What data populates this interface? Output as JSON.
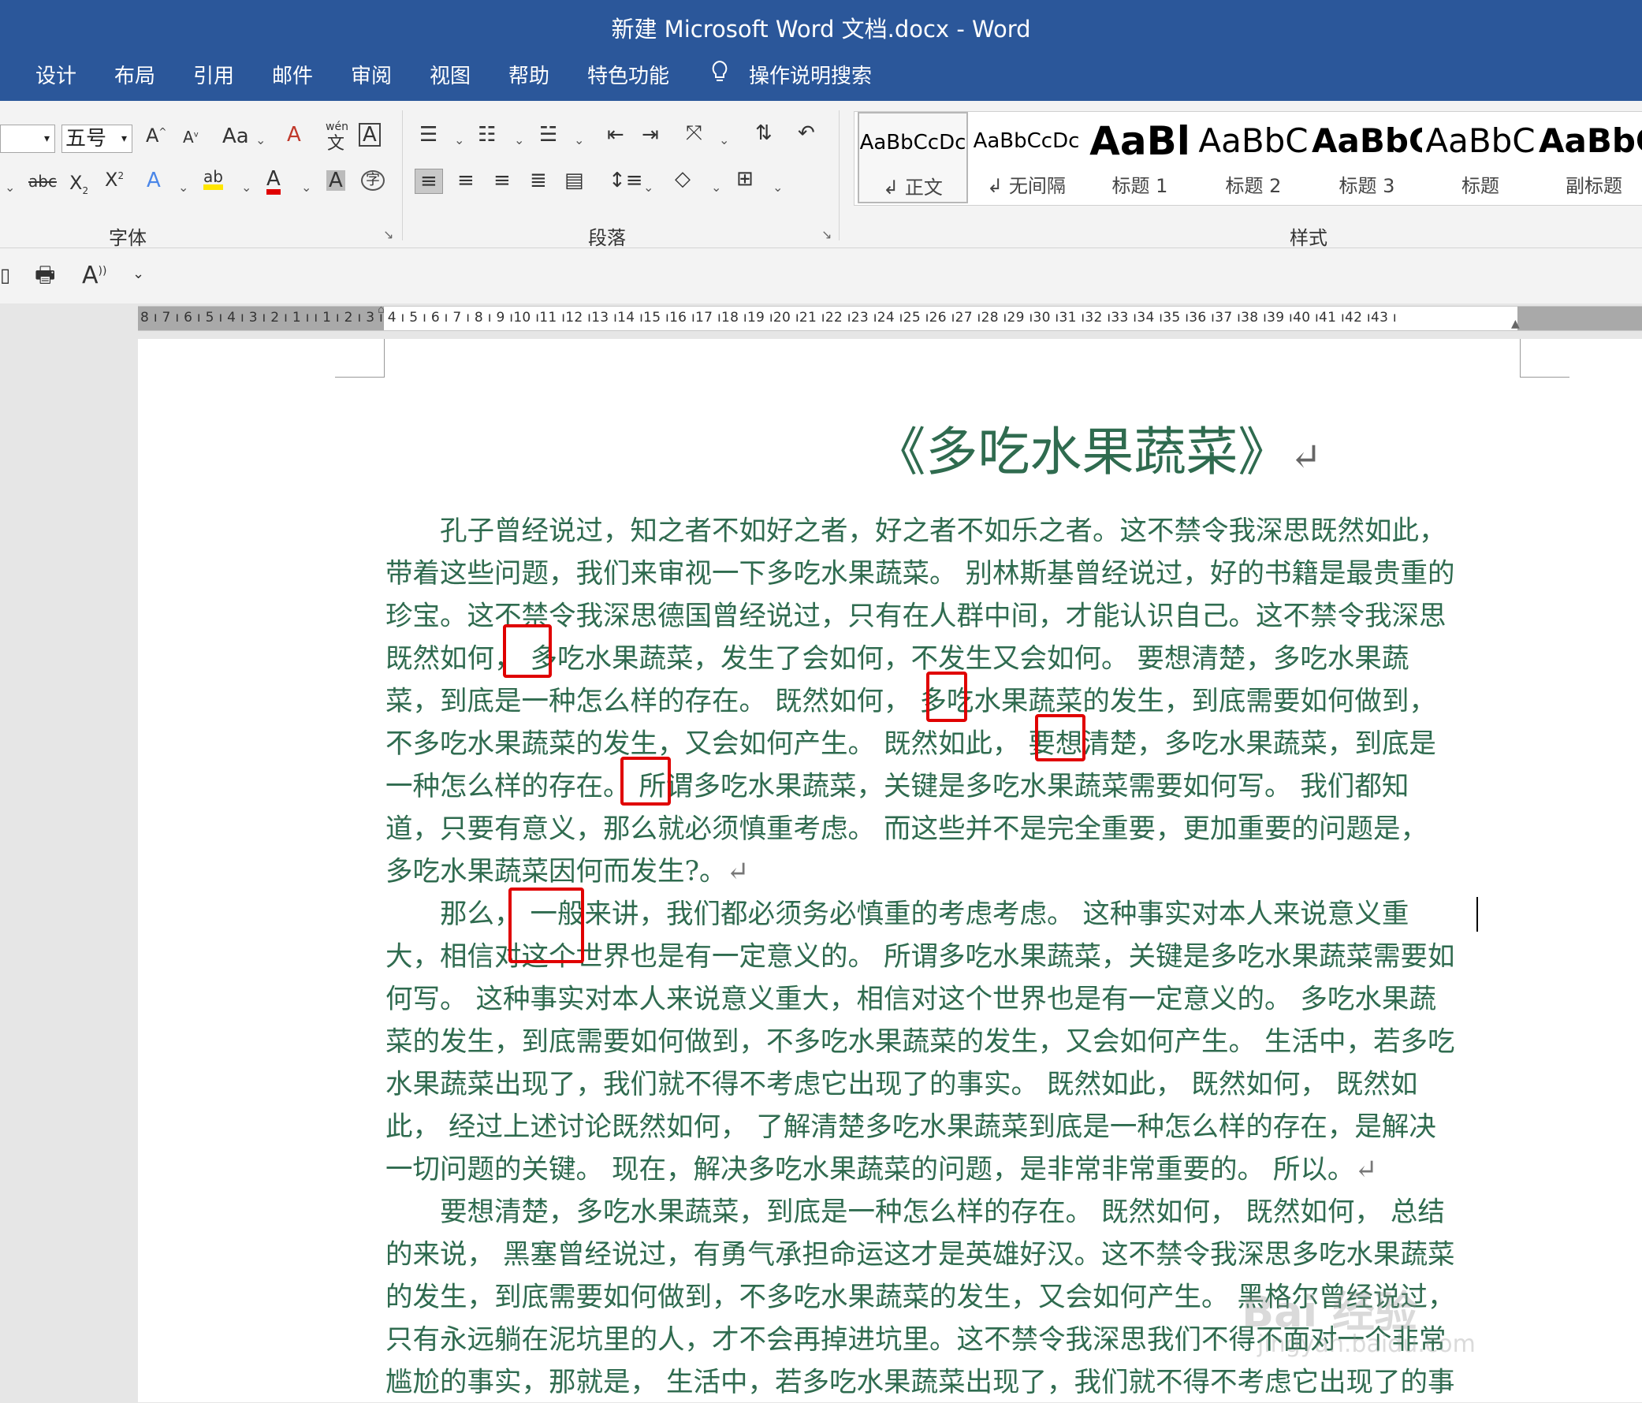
{
  "window": {
    "title": "新建 Microsoft Word 文档.docx  -  Word"
  },
  "tabs": [
    "设计",
    "布局",
    "引用",
    "邮件",
    "审阅",
    "视图",
    "帮助",
    "特色功能"
  ],
  "tell_me": "操作说明搜索",
  "font": {
    "size": "五号",
    "group_label": "字体",
    "case_btn": "Aa",
    "phonetic": "wén"
  },
  "paragraph": {
    "group_label": "段落"
  },
  "styles": {
    "group_label": "样式",
    "items": [
      {
        "preview": "AaBbCcDc",
        "name": "↲ 正文"
      },
      {
        "preview": "AaBbCcDc",
        "name": "↲ 无间隔"
      },
      {
        "preview": "AaBl",
        "name": "标题 1"
      },
      {
        "preview": "AaBbC",
        "name": "标题 2"
      },
      {
        "preview": "AaBbC",
        "name": "标题 3"
      },
      {
        "preview": "AaBbC",
        "name": "标题"
      },
      {
        "preview": "AaBbC",
        "name": "副标题"
      }
    ]
  },
  "ruler": {
    "text": "8 ı 7 ı 6 ı 5 ı 4 ı 3 ı 2 ı 1 ı     ı 1 ı 2 ı 3 ı 4 ı 5 ı 6 ı 7 ı 8 ı 9 ı10 ı11 ı12 ı13 ı14 ı15 ı16 ı17 ı18 ı19 ı20 ı21 ı22 ı23 ı24 ı25 ı26 ı27 ı28 ı29 ı30 ı31 ı32 ı33 ı34 ı35 ı36 ı37 ı38 ı39 ı40 ı41 ı42 ı43 ı"
  },
  "document": {
    "title": "《多吃水果蔬菜》",
    "paragraph_mark": "↵",
    "lines": [
      "　　孔子曾经说过，知之者不如好之者，好之者不如乐之者。这不禁令我深思既然如此，",
      "带着这些问题，我们来审视一下多吃水果蔬菜。 别林斯基曾经说过，好的书籍是最贵重的",
      "珍宝。这不禁令我深思德国曾经说过，只有在人群中间，才能认识自己。这不禁令我深思",
      "既然如何， 多吃水果蔬菜，发生了会如何，不发生又会如何。 要想清楚，多吃水果蔬",
      "菜，到底是一种怎么样的存在。 既然如何， 多吃水果蔬菜的发生，到底需要如何做到，",
      "不多吃水果蔬菜的发生，又会如何产生。 既然如此， 要想清楚，多吃水果蔬菜，到底是",
      "一种怎么样的存在。 所谓多吃水果蔬菜，关键是多吃水果蔬菜需要如何写。 我们都知",
      "道，只要有意义，那么就必须慎重考虑。 而这些并不是完全重要，更加重要的问题是，",
      "多吃水果蔬菜因何而发生?。",
      "　　那么， 一般来讲，我们都必须务必慎重的考虑考虑。 这种事实对本人来说意义重",
      "大，相信对这个世界也是有一定意义的。 所谓多吃水果蔬菜，关键是多吃水果蔬菜需要如",
      "何写。 这种事实对本人来说意义重大，相信对这个世界也是有一定意义的。 多吃水果蔬",
      "菜的发生，到底需要如何做到，不多吃水果蔬菜的发生，又会如何产生。 生活中，若多吃",
      "水果蔬菜出现了，我们就不得不考虑它出现了的事实。 既然如此， 既然如何， 既然如",
      "此， 经过上述讨论既然如何， 了解清楚多吃水果蔬菜到底是一种怎么样的存在，是解决",
      "一切问题的关键。 现在，解决多吃水果蔬菜的问题，是非常非常重要的。 所以。",
      "　　要想清楚，多吃水果蔬菜，到底是一种怎么样的存在。 既然如何， 既然如何， 总结",
      "的来说， 黑塞曾经说过，有勇气承担命运这才是英雄好汉。这不禁令我深思多吃水果蔬菜",
      "的发生，到底需要如何做到，不多吃水果蔬菜的发生，又会如何产生。 黑格尔曾经说过，",
      "只有永远躺在泥坑里的人，才不会再掉进坑里。这不禁令我深思我们不得不面对一个非常",
      "尴尬的事实，那就是， 生活中，若多吃水果蔬菜出现了，我们就不得不考虑它出现了的事"
    ]
  },
  "watermark": {
    "main": "Bai 经验",
    "sub": "jingyan.baidu.com"
  },
  "colors": {
    "accent": "#2b579a",
    "doc_text": "#2f6b4f",
    "highlight_box": "#e00000"
  }
}
